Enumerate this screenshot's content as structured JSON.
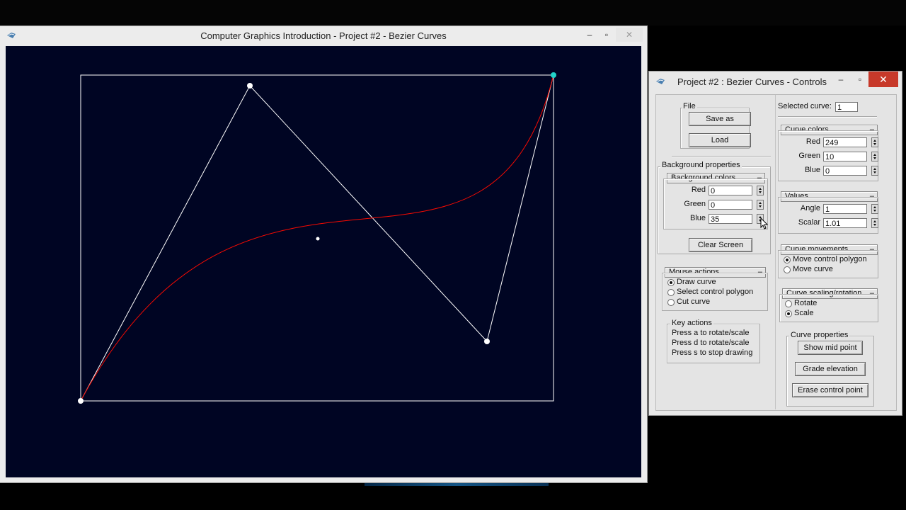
{
  "main_window": {
    "title": "Computer Graphics Introduction - Project #2 - Bezier Curves",
    "controls": {
      "minimize": "–",
      "maximize": "▫",
      "close": "✕"
    }
  },
  "canvas": {
    "background_color": "#000523",
    "curve_color": "#f90a00",
    "polygon_color": "#ffffff",
    "selected_point_color": "#22d3c8"
  },
  "controls_window": {
    "title": "Project #2 : Bezier Curves - Controls",
    "controls": {
      "minimize": "–",
      "maximize": "▫",
      "close": "✕"
    },
    "file": {
      "label": "File",
      "save_label": "Save as",
      "load_label": "Load"
    },
    "background_properties": {
      "label": "Background properties",
      "colors_rollout": "Background colors",
      "red_label": "Red",
      "red_value": "0",
      "green_label": "Green",
      "green_value": "0",
      "blue_label": "Blue",
      "blue_value": "35"
    },
    "clear_screen_label": "Clear Screen",
    "mouse_actions": {
      "label": "Mouse actions",
      "options": [
        "Draw curve",
        "Select control polygon",
        "Cut curve"
      ],
      "selected": "Draw curve"
    },
    "key_actions": {
      "label": "Key actions",
      "lines": [
        "Press a to rotate/scale",
        "Press d to rotate/scale",
        "Press s to stop drawing"
      ]
    },
    "selected_curve": {
      "label": "Selected curve:",
      "value": "1"
    },
    "curve_colors": {
      "label": "Curve colors",
      "red_label": "Red",
      "red_value": "249",
      "green_label": "Green",
      "green_value": "10",
      "blue_label": "Blue",
      "blue_value": "0"
    },
    "values": {
      "label": "Values",
      "angle_label": "Angle",
      "angle_value": "1",
      "scalar_label": "Scalar",
      "scalar_value": "1.01"
    },
    "curve_movements": {
      "label": "Curve movements",
      "options": [
        "Move control polygon",
        "Move curve"
      ],
      "selected": "Move control polygon"
    },
    "curve_scaling": {
      "label": "Curve scaling/rotation",
      "options": [
        "Rotate",
        "Scale"
      ],
      "selected": "Scale"
    },
    "curve_properties": {
      "label": "Curve properties",
      "show_mid_point": "Show mid point",
      "grade_elevation": "Grade elevation",
      "erase_control_point": "Erase control point"
    }
  }
}
